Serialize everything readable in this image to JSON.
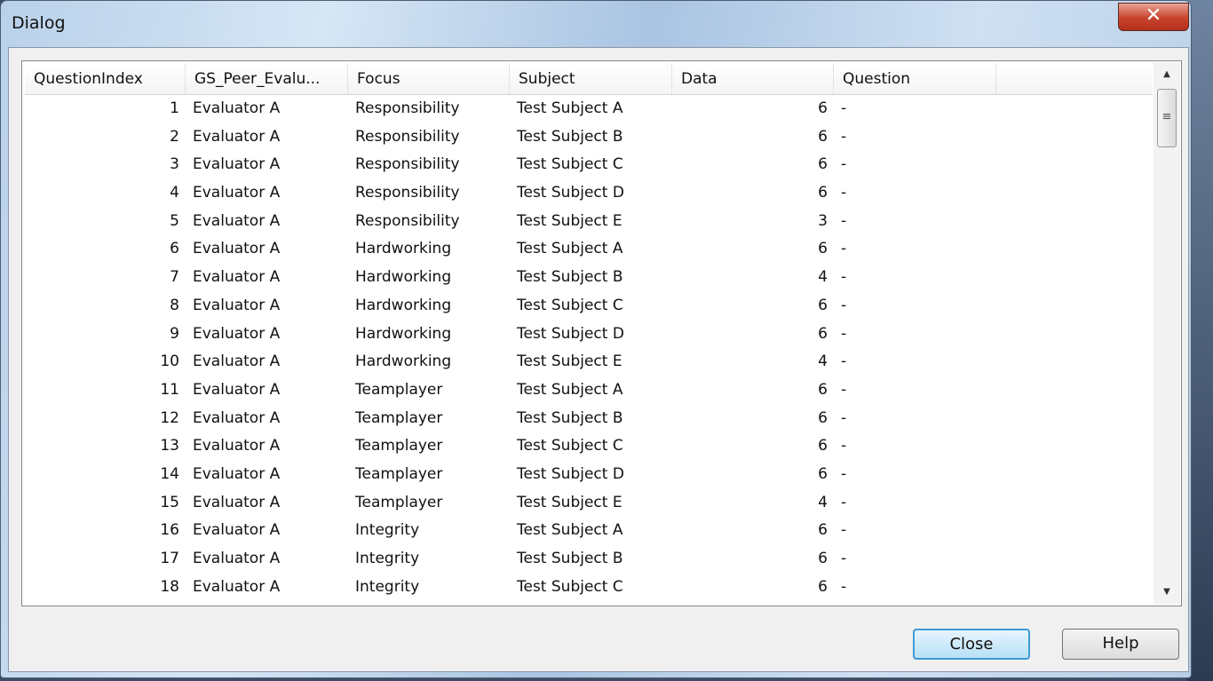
{
  "window": {
    "title": "Dialog",
    "close_glyph": "✕"
  },
  "table": {
    "columns": [
      "QuestionIndex",
      "GS_Peer_Evalu...",
      "Focus",
      "Subject",
      "Data",
      "Question"
    ],
    "rows": [
      [
        "1",
        "Evaluator A",
        "Responsibility",
        "Test Subject A",
        "6",
        "-"
      ],
      [
        "2",
        "Evaluator A",
        "Responsibility",
        "Test Subject B",
        "6",
        "-"
      ],
      [
        "3",
        "Evaluator A",
        "Responsibility",
        "Test Subject C",
        "6",
        "-"
      ],
      [
        "4",
        "Evaluator A",
        "Responsibility",
        "Test Subject D",
        "6",
        "-"
      ],
      [
        "5",
        "Evaluator A",
        "Responsibility",
        "Test Subject E",
        "3",
        "-"
      ],
      [
        "6",
        "Evaluator A",
        "Hardworking",
        "Test Subject A",
        "6",
        "-"
      ],
      [
        "7",
        "Evaluator A",
        "Hardworking",
        "Test Subject B",
        "4",
        "-"
      ],
      [
        "8",
        "Evaluator A",
        "Hardworking",
        "Test Subject C",
        "6",
        "-"
      ],
      [
        "9",
        "Evaluator A",
        "Hardworking",
        "Test Subject D",
        "6",
        "-"
      ],
      [
        "10",
        "Evaluator A",
        "Hardworking",
        "Test Subject E",
        "4",
        "-"
      ],
      [
        "11",
        "Evaluator A",
        "Teamplayer",
        "Test Subject A",
        "6",
        "-"
      ],
      [
        "12",
        "Evaluator A",
        "Teamplayer",
        "Test Subject B",
        "6",
        "-"
      ],
      [
        "13",
        "Evaluator A",
        "Teamplayer",
        "Test Subject C",
        "6",
        "-"
      ],
      [
        "14",
        "Evaluator A",
        "Teamplayer",
        "Test Subject D",
        "6",
        "-"
      ],
      [
        "15",
        "Evaluator A",
        "Teamplayer",
        "Test Subject E",
        "4",
        "-"
      ],
      [
        "16",
        "Evaluator A",
        "Integrity",
        "Test Subject A",
        "6",
        "-"
      ],
      [
        "17",
        "Evaluator A",
        "Integrity",
        "Test Subject B",
        "6",
        "-"
      ],
      [
        "18",
        "Evaluator A",
        "Integrity",
        "Test Subject C",
        "6",
        "-"
      ]
    ]
  },
  "buttons": {
    "close": "Close",
    "help": "Help"
  }
}
